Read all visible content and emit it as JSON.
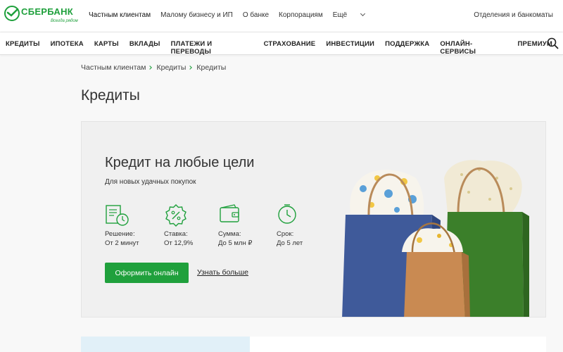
{
  "header": {
    "logo": {
      "brand": "СБЕРБАНК",
      "tagline": "Всегда рядом"
    },
    "nav": [
      "Частным клиентам",
      "Малому бизнесу и ИП",
      "О банке",
      "Корпорациям",
      "Ещё"
    ],
    "right_link": "Отделения и банкоматы"
  },
  "mainnav": {
    "items": [
      "КРЕДИТЫ",
      "ИПОТЕКА",
      "КАРТЫ",
      "ВКЛАДЫ",
      "ПЛАТЕЖИ И ПЕРЕВОДЫ",
      "СТРАХОВАНИЕ",
      "ИНВЕСТИЦИИ",
      "ПОДДЕРЖКА",
      "ОНЛАЙН-СЕРВИСЫ",
      "ПРЕМИУМ"
    ],
    "search_icon": "search-icon"
  },
  "breadcrumb": [
    "Частным клиентам",
    "Кредиты",
    "Кредиты"
  ],
  "page": {
    "title": "Кредиты"
  },
  "promo": {
    "title": "Кредит на любые цели",
    "subtitle": "Для новых удачных покупок",
    "features": [
      {
        "icon": "document-timer-icon",
        "label": "Решение:",
        "value": "От 2 минут"
      },
      {
        "icon": "percent-badge-icon",
        "label": "Ставка:",
        "value": "От 12,9%"
      },
      {
        "icon": "wallet-icon",
        "label": "Сумма:",
        "value": "До 5 млн ₽"
      },
      {
        "icon": "clock-icon",
        "label": "Срок:",
        "value": "До 5 лет"
      }
    ],
    "primary_button": "Оформить онлайн",
    "secondary_link": "Узнать больше"
  },
  "colors": {
    "brand_green": "#1fa03c",
    "bag_blue": "#3f5a9a",
    "bag_green": "#3b7f2a",
    "bag_kraft": "#c98a52"
  }
}
